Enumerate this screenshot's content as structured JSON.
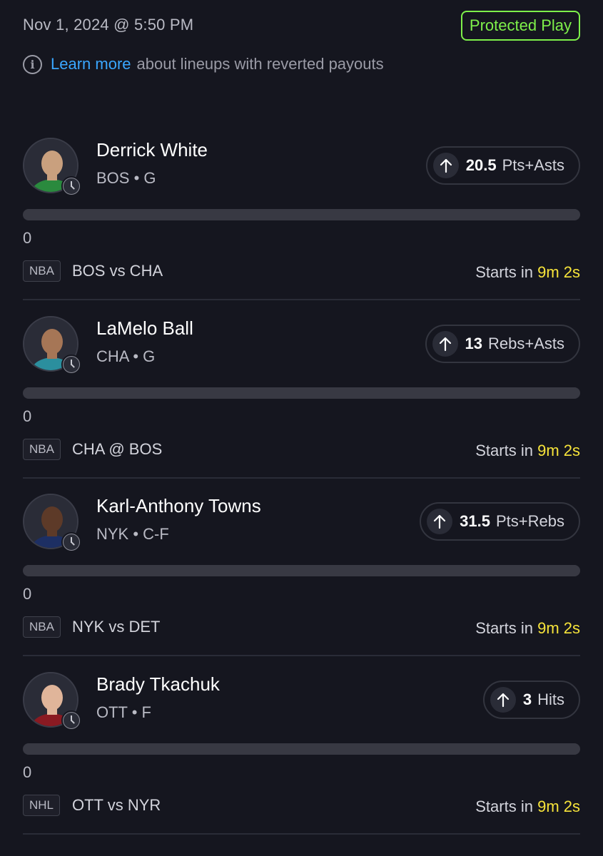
{
  "header": {
    "date": "Nov 1, 2024 @ 5:50 PM",
    "badge": "Protected Play",
    "info_link": "Learn more",
    "info_text": "about lineups with reverted payouts"
  },
  "picks": [
    {
      "name": "Derrick White",
      "meta": "BOS • G",
      "stat_value": "20.5",
      "stat_type": "Pts+Asts",
      "progress": "0",
      "progress_fraction": 0,
      "league": "NBA",
      "matchup": "BOS  vs CHA",
      "starts_label": "Starts in",
      "countdown": "9m 2s",
      "jersey_color": "#2a8a3e",
      "skin_color": "#c9a07e"
    },
    {
      "name": "LaMelo Ball",
      "meta": "CHA • G",
      "stat_value": "13",
      "stat_type": "Rebs+Asts",
      "progress": "0",
      "progress_fraction": 0,
      "league": "NBA",
      "matchup": "CHA  @ BOS",
      "starts_label": "Starts in",
      "countdown": "9m 2s",
      "jersey_color": "#2b8f9e",
      "skin_color": "#a67656"
    },
    {
      "name": "Karl-Anthony Towns",
      "meta": "NYK • C-F",
      "stat_value": "31.5",
      "stat_type": "Pts+Rebs",
      "progress": "0",
      "progress_fraction": 0,
      "league": "NBA",
      "matchup": "NYK  vs DET",
      "starts_label": "Starts in",
      "countdown": "9m 2s",
      "jersey_color": "#1d2f63",
      "skin_color": "#5d3a28"
    },
    {
      "name": "Brady Tkachuk",
      "meta": "OTT • F",
      "stat_value": "3",
      "stat_type": "Hits",
      "progress": "0",
      "progress_fraction": 0,
      "league": "NHL",
      "matchup": "OTT  vs NYR",
      "starts_label": "Starts in",
      "countdown": "9m 2s",
      "jersey_color": "#8a1a22",
      "skin_color": "#e0b59a"
    }
  ],
  "colors": {
    "background": "#15161f",
    "accent_green": "#7ef04a",
    "link_blue": "#3aa7ff",
    "countdown_yellow": "#f7e43a"
  },
  "icons": {
    "info": "info-circle-icon",
    "arrow": "arrow-up-icon",
    "clock": "clock-icon"
  }
}
